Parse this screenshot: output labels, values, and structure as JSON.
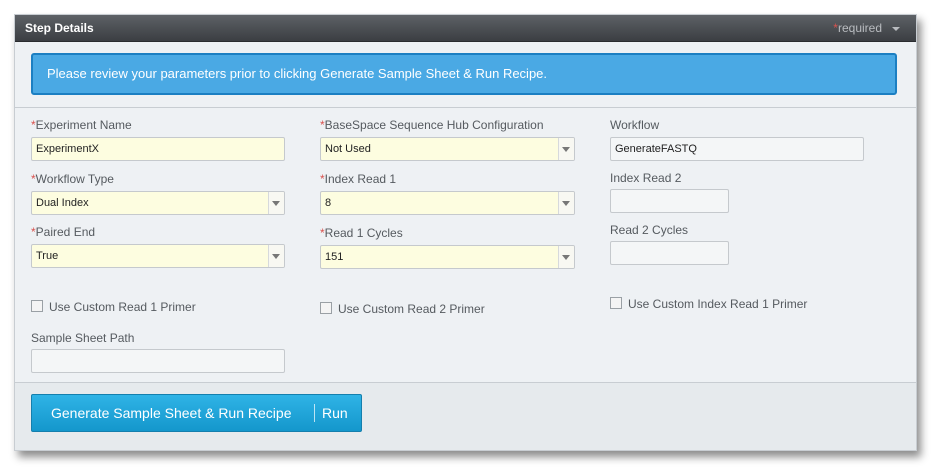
{
  "header": {
    "title": "Step Details",
    "required_star": "*",
    "required_label": "required",
    "toggle_icon": "chevron-down-icon"
  },
  "info": {
    "message": "Please review your parameters prior to clicking Generate Sample Sheet & Run Recipe."
  },
  "form": {
    "experiment_name": {
      "star": "*",
      "label": "Experiment Name",
      "value": "ExperimentX"
    },
    "basespace_config": {
      "star": "*",
      "label": "BaseSpace Sequence Hub Configuration",
      "value": "Not Used"
    },
    "workflow": {
      "label": "Workflow",
      "value": "GenerateFASTQ"
    },
    "workflow_type": {
      "star": "*",
      "label": "Workflow Type",
      "value": "Dual Index"
    },
    "index_read_1": {
      "star": "*",
      "label": "Index Read 1",
      "value": "8"
    },
    "index_read_2": {
      "label": "Index Read 2",
      "value": ""
    },
    "paired_end": {
      "star": "*",
      "label": "Paired End",
      "value": "True"
    },
    "read_1_cycles": {
      "star": "*",
      "label": "Read 1 Cycles",
      "value": "151"
    },
    "read_2_cycles": {
      "label": "Read 2 Cycles",
      "value": ""
    },
    "custom_read1_primer": {
      "label": "Use Custom Read 1 Primer",
      "checked": false
    },
    "custom_read2_primer": {
      "label": "Use Custom Read 2 Primer",
      "checked": false
    },
    "custom_index_read1_primer": {
      "label": "Use Custom Index Read 1 Primer",
      "checked": false
    },
    "sample_sheet_path": {
      "label": "Sample Sheet Path",
      "value": ""
    }
  },
  "actions": {
    "generate_label": "Generate Sample Sheet & Run Recipe",
    "run_label": "Run"
  },
  "colors": {
    "info_bg": "#4aa9e4",
    "button_bg": "#1ea5dc",
    "required_star": "#d9534f",
    "field_bg": "#fdfde0"
  }
}
